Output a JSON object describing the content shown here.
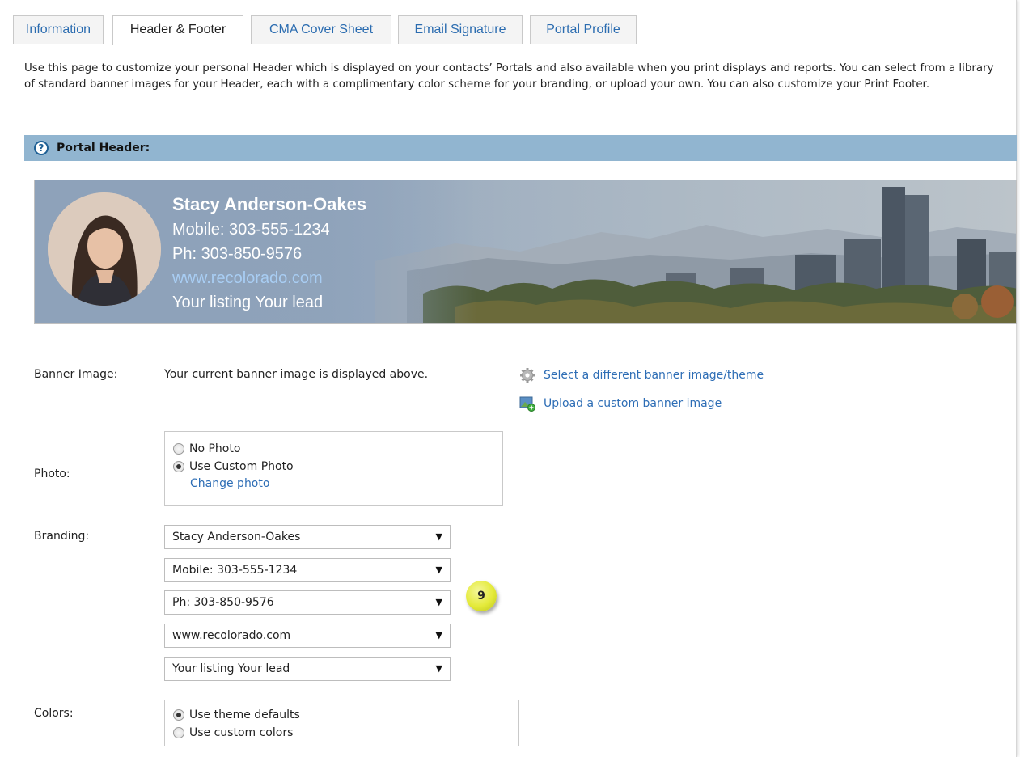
{
  "tabs": [
    {
      "label": "Information",
      "active": false
    },
    {
      "label": "Header & Footer",
      "active": true
    },
    {
      "label": "CMA Cover Sheet",
      "active": false
    },
    {
      "label": "Email Signature",
      "active": false
    },
    {
      "label": "Portal Profile",
      "active": false
    }
  ],
  "intro_text": "Use this page to customize your personal Header which is displayed on your contacts’ Portals and also available when you print displays and reports. You can select from a library of standard banner images for your Header, each with a complimentary color scheme for your branding, or upload your own. You can also customize your Print Footer.",
  "section": {
    "title": "Portal Header:",
    "help_icon": "question-circle-icon"
  },
  "banner": {
    "name": "Stacy Anderson-Oakes",
    "mobile": "Mobile: 303-555-1234",
    "phone": "Ph: 303-850-9576",
    "website": "www.recolorado.com",
    "tagline": "Your listing Your lead"
  },
  "banner_image": {
    "label": "Banner Image:",
    "status_text": "Your current banner image is displayed above.",
    "select_link": "Select a different banner image/theme",
    "select_icon": "gear-icon",
    "upload_link": "Upload a custom banner image",
    "upload_icon": "image-add-icon"
  },
  "photo": {
    "label": "Photo:",
    "options": [
      {
        "label": "No Photo",
        "checked": false
      },
      {
        "label": "Use Custom Photo",
        "checked": true
      }
    ],
    "change_link": "Change photo"
  },
  "branding": {
    "label": "Branding:",
    "selects": [
      "Stacy Anderson-Oakes",
      "Mobile: 303-555-1234",
      "Ph: 303-850-9576",
      "www.recolorado.com",
      "Your listing Your lead"
    ],
    "caret": "▼"
  },
  "callout": {
    "number": "9"
  },
  "colors": {
    "label": "Colors:",
    "options": [
      {
        "label": "Use theme defaults",
        "checked": true
      },
      {
        "label": "Use custom colors",
        "checked": false
      }
    ]
  },
  "theme": {
    "link_color": "#2d6db5",
    "section_bar_color": "#91b5d0"
  }
}
